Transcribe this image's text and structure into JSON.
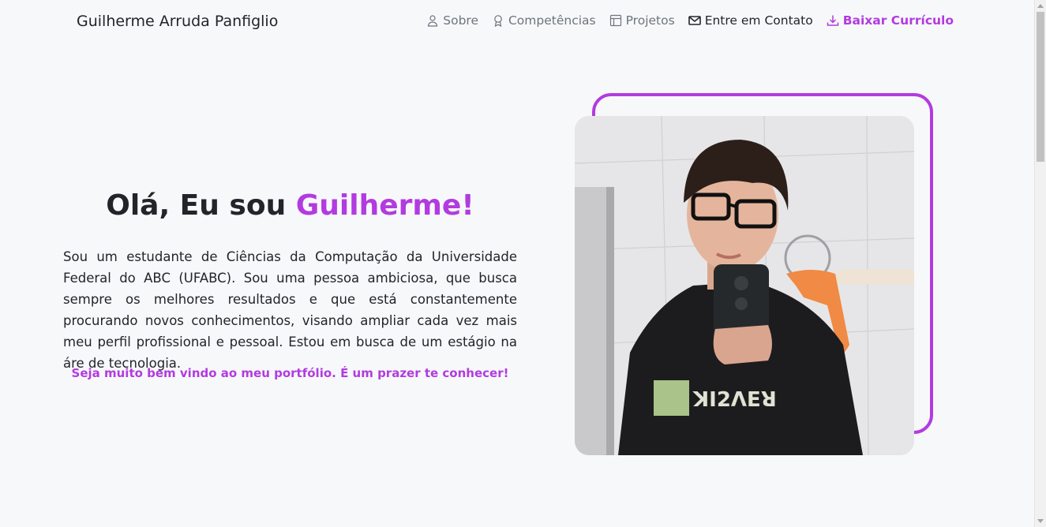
{
  "navbar": {
    "brand": "Guilherme Arruda Panfiglio",
    "items": [
      {
        "label": "Sobre",
        "icon": "person-icon"
      },
      {
        "label": "Competências",
        "icon": "award-icon"
      },
      {
        "label": "Projetos",
        "icon": "layout-icon"
      },
      {
        "label": "Entre em Contato",
        "icon": "envelope-icon"
      },
      {
        "label": "Baixar Currículo",
        "icon": "download-icon"
      }
    ]
  },
  "hero": {
    "greeting": "Olá, Eu sou ",
    "name": "Guilherme!",
    "description": "Sou um estudante de Ciências da Computação da Universidade Federal do ABC (UFABC). Sou uma pessoa ambiciosa, que busca sempre os melhores resultados e que está constantemente procurando novos conhecimentos, visando ampliar cada vez mais meu perfil profissional e pessoal. Estou em busca de um estágio na áre de tecnologia.",
    "welcome": "Seja muito bem vindo ao meu portfólio. É um prazer te conhecer!",
    "photo_alt": "profile-photo"
  },
  "colors": {
    "accent": "#b23be0",
    "background": "#f7f8fa",
    "text": "#212529",
    "muted": "#6c757d"
  }
}
